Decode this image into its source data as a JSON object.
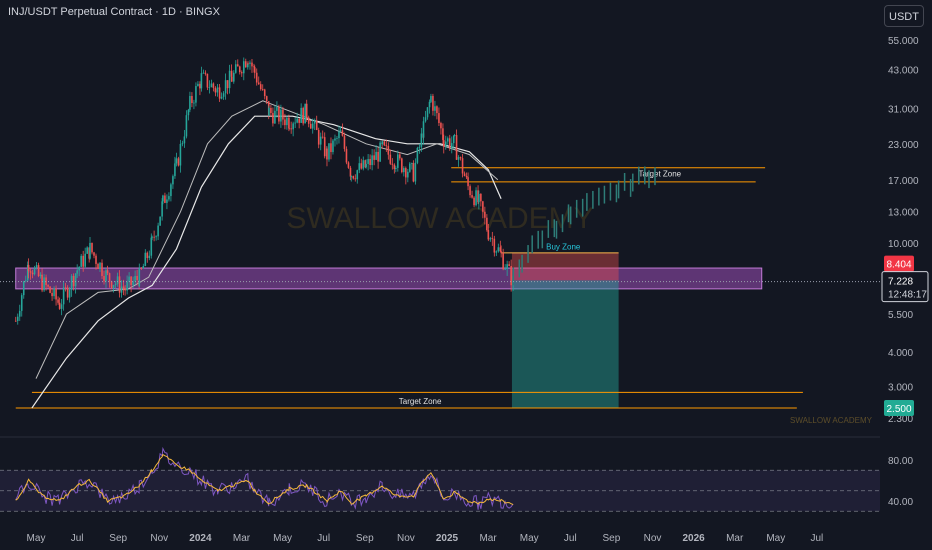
{
  "header": {
    "title": "INJ/USDT Perpetual Contract · 1D · BINGX",
    "currency_button": "USDT"
  },
  "watermark": "SWALLOW ACADEMY",
  "watermark_small": "SWALLOW ACADEMY",
  "colors": {
    "background": "#131722",
    "bull": "#26a69a",
    "bear": "#ef5350",
    "zone_line": "#ff9800",
    "support_box": "#9c4fb8",
    "rsi_line": "#7e57c2",
    "rsi_ma": "#f6b93b",
    "price_badge_red": "#f23645",
    "price_badge_green": "#22ab94",
    "projection": "#2e7d78"
  },
  "chart_data": {
    "type": "candlestick",
    "symbol": "INJ/USDT Perpetual Contract",
    "interval": "1D",
    "exchange": "BINGX",
    "y_scale": "log",
    "y_ticks": [
      "55.000",
      "43.000",
      "31.000",
      "23.000",
      "17.000",
      "13.000",
      "10.000",
      "5.500",
      "4.000",
      "3.000",
      "2.300"
    ],
    "x_ticks": [
      {
        "label": "May",
        "bold": false
      },
      {
        "label": "Jul",
        "bold": false
      },
      {
        "label": "Sep",
        "bold": false
      },
      {
        "label": "Nov",
        "bold": false
      },
      {
        "label": "2024",
        "bold": true
      },
      {
        "label": "Mar",
        "bold": false
      },
      {
        "label": "May",
        "bold": false
      },
      {
        "label": "Jul",
        "bold": false
      },
      {
        "label": "Sep",
        "bold": false
      },
      {
        "label": "Nov",
        "bold": false
      },
      {
        "label": "2025",
        "bold": true
      },
      {
        "label": "Mar",
        "bold": false
      },
      {
        "label": "May",
        "bold": false
      },
      {
        "label": "Jul",
        "bold": false
      },
      {
        "label": "Sep",
        "bold": false
      },
      {
        "label": "Nov",
        "bold": false
      },
      {
        "label": "2026",
        "bold": true
      },
      {
        "label": "Mar",
        "bold": false
      },
      {
        "label": "May",
        "bold": false
      },
      {
        "label": "Jul",
        "bold": false
      }
    ],
    "price_path_points": [
      [
        "2023-04-01",
        5.2
      ],
      [
        "2023-04-20",
        8.5
      ],
      [
        "2023-05-10",
        7.2
      ],
      [
        "2023-06-05",
        6.0
      ],
      [
        "2023-07-01",
        8.0
      ],
      [
        "2023-07-20",
        9.5
      ],
      [
        "2023-08-15",
        7.5
      ],
      [
        "2023-09-10",
        6.8
      ],
      [
        "2023-10-01",
        7.5
      ],
      [
        "2023-10-20",
        10.0
      ],
      [
        "2023-11-05",
        14.0
      ],
      [
        "2023-11-25",
        19.0
      ],
      [
        "2023-12-15",
        32.0
      ],
      [
        "2024-01-01",
        40.0
      ],
      [
        "2024-01-25",
        36.0
      ],
      [
        "2024-02-15",
        40.0
      ],
      [
        "2024-03-10",
        48.0
      ],
      [
        "2024-03-20",
        42.0
      ],
      [
        "2024-04-10",
        30.0
      ],
      [
        "2024-05-10",
        28.0
      ],
      [
        "2024-06-05",
        30.0
      ],
      [
        "2024-07-05",
        21.0
      ],
      [
        "2024-07-25",
        25.0
      ],
      [
        "2024-08-10",
        18.0
      ],
      [
        "2024-09-01",
        19.0
      ],
      [
        "2024-09-25",
        22.0
      ],
      [
        "2024-10-15",
        20.0
      ],
      [
        "2024-11-10",
        18.0
      ],
      [
        "2024-11-25",
        26.0
      ],
      [
        "2024-12-06",
        34.0
      ],
      [
        "2024-12-25",
        24.0
      ],
      [
        "2025-01-10",
        23.0
      ],
      [
        "2025-01-30",
        16.0
      ],
      [
        "2025-02-15",
        14.0
      ],
      [
        "2025-03-01",
        11.0
      ],
      [
        "2025-03-20",
        9.0
      ],
      [
        "2025-04-07",
        7.2
      ]
    ],
    "ema_fast_points": [
      [
        "2023-05-01",
        3.2
      ],
      [
        "2023-06-15",
        5.5
      ],
      [
        "2023-08-01",
        6.6
      ],
      [
        "2023-09-15",
        6.8
      ],
      [
        "2023-10-15",
        7.5
      ],
      [
        "2023-12-01",
        13.0
      ],
      [
        "2024-01-10",
        23.0
      ],
      [
        "2024-02-15",
        29.0
      ],
      [
        "2024-04-01",
        33.0
      ],
      [
        "2024-05-15",
        30.0
      ],
      [
        "2024-07-01",
        27.0
      ],
      [
        "2024-09-01",
        23.0
      ],
      [
        "2024-11-01",
        21.0
      ],
      [
        "2024-12-15",
        23.0
      ],
      [
        "2025-02-01",
        21.0
      ],
      [
        "2025-03-15",
        17.0
      ]
    ],
    "ema_slow_points": [
      [
        "2023-04-25",
        2.5
      ],
      [
        "2023-06-15",
        3.8
      ],
      [
        "2023-08-01",
        5.2
      ],
      [
        "2023-09-15",
        6.3
      ],
      [
        "2023-10-20",
        7.0
      ],
      [
        "2023-11-25",
        9.5
      ],
      [
        "2024-01-01",
        16.0
      ],
      [
        "2024-02-10",
        23.0
      ],
      [
        "2024-03-20",
        29.0
      ],
      [
        "2024-05-15",
        29.0
      ],
      [
        "2024-07-15",
        27.0
      ],
      [
        "2024-09-15",
        24.0
      ],
      [
        "2024-11-01",
        23.0
      ],
      [
        "2024-12-20",
        23.0
      ],
      [
        "2025-02-01",
        21.5
      ],
      [
        "2025-03-01",
        18.5
      ],
      [
        "2025-03-20",
        14.5
      ]
    ],
    "projection_points": [
      [
        "2025-04-07",
        7.5
      ],
      [
        "2025-04-20",
        8.5
      ],
      [
        "2025-05-05",
        9.5
      ],
      [
        "2025-05-20",
        10.5
      ],
      [
        "2025-06-10",
        11.5
      ],
      [
        "2025-07-01",
        12.5
      ],
      [
        "2025-07-25",
        13.5
      ],
      [
        "2025-08-20",
        14.5
      ],
      [
        "2025-09-10",
        15.5
      ],
      [
        "2025-10-01",
        16.5
      ],
      [
        "2025-10-25",
        17.5
      ],
      [
        "2025-11-10",
        18.5
      ]
    ],
    "support_zone": {
      "from": "2023-04-01",
      "to": "2026-04-10",
      "low": 6.8,
      "high": 8.1
    },
    "long_position": {
      "from": "2025-04-05",
      "to": "2025-09-10",
      "entry": 7.3,
      "stop": 9.2,
      "target": 2.5,
      "buy_zone_line": 9.2
    },
    "annotations": [
      {
        "text": "Target Zone",
        "from": "2025-01-05",
        "to": "2026-04-15",
        "price": 18.8,
        "label_price": 17.9,
        "label_date": "2025-11-10"
      },
      {
        "text": "",
        "from": "2025-01-05",
        "to": "2026-04-01",
        "price": 16.7
      },
      {
        "text": "Buy Zone",
        "from": "2025-03-20",
        "to": "2025-09-10",
        "price": 9.2,
        "label_price": 9.7,
        "label_date": "2025-06-20"
      },
      {
        "text": "Target Zone",
        "from": "2023-04-25",
        "to": "2026-06-10",
        "price": 2.85,
        "label_price": 2.65,
        "label_date": "2024-11-20"
      },
      {
        "text": "",
        "from": "2023-04-01",
        "to": "2026-06-01",
        "price": 2.5
      }
    ],
    "current_price": 7.228,
    "countdown": "12:48:17",
    "level_red": 8.404,
    "level_green": 2.5,
    "price_labels": {
      "red": "8.404",
      "current": "7.228",
      "green": "2.500"
    },
    "rsi": {
      "y_ticks": [
        80,
        40
      ],
      "y_tick_labels": [
        "80.00",
        "40.00"
      ],
      "overbought": 70,
      "oversold": 30,
      "midline": 50,
      "points": [
        [
          "2023-04-01",
          40
        ],
        [
          "2023-04-20",
          60
        ],
        [
          "2023-05-10",
          45
        ],
        [
          "2023-06-05",
          40
        ],
        [
          "2023-07-01",
          55
        ],
        [
          "2023-07-20",
          60
        ],
        [
          "2023-08-15",
          40
        ],
        [
          "2023-09-10",
          45
        ],
        [
          "2023-10-01",
          55
        ],
        [
          "2023-10-20",
          70
        ],
        [
          "2023-11-05",
          85
        ],
        [
          "2023-11-25",
          75
        ],
        [
          "2023-12-15",
          70
        ],
        [
          "2024-01-01",
          60
        ],
        [
          "2024-01-25",
          50
        ],
        [
          "2024-02-15",
          55
        ],
        [
          "2024-03-10",
          60
        ],
        [
          "2024-03-20",
          50
        ],
        [
          "2024-04-10",
          38
        ],
        [
          "2024-05-10",
          52
        ],
        [
          "2024-06-05",
          55
        ],
        [
          "2024-07-05",
          40
        ],
        [
          "2024-07-25",
          50
        ],
        [
          "2024-08-10",
          38
        ],
        [
          "2024-09-01",
          45
        ],
        [
          "2024-09-25",
          55
        ],
        [
          "2024-10-15",
          45
        ],
        [
          "2024-11-10",
          45
        ],
        [
          "2024-11-25",
          60
        ],
        [
          "2024-12-06",
          68
        ],
        [
          "2024-12-25",
          42
        ],
        [
          "2025-01-10",
          48
        ],
        [
          "2025-01-30",
          40
        ],
        [
          "2025-02-15",
          38
        ],
        [
          "2025-03-01",
          42
        ],
        [
          "2025-03-20",
          40
        ],
        [
          "2025-04-07",
          37
        ]
      ]
    }
  }
}
